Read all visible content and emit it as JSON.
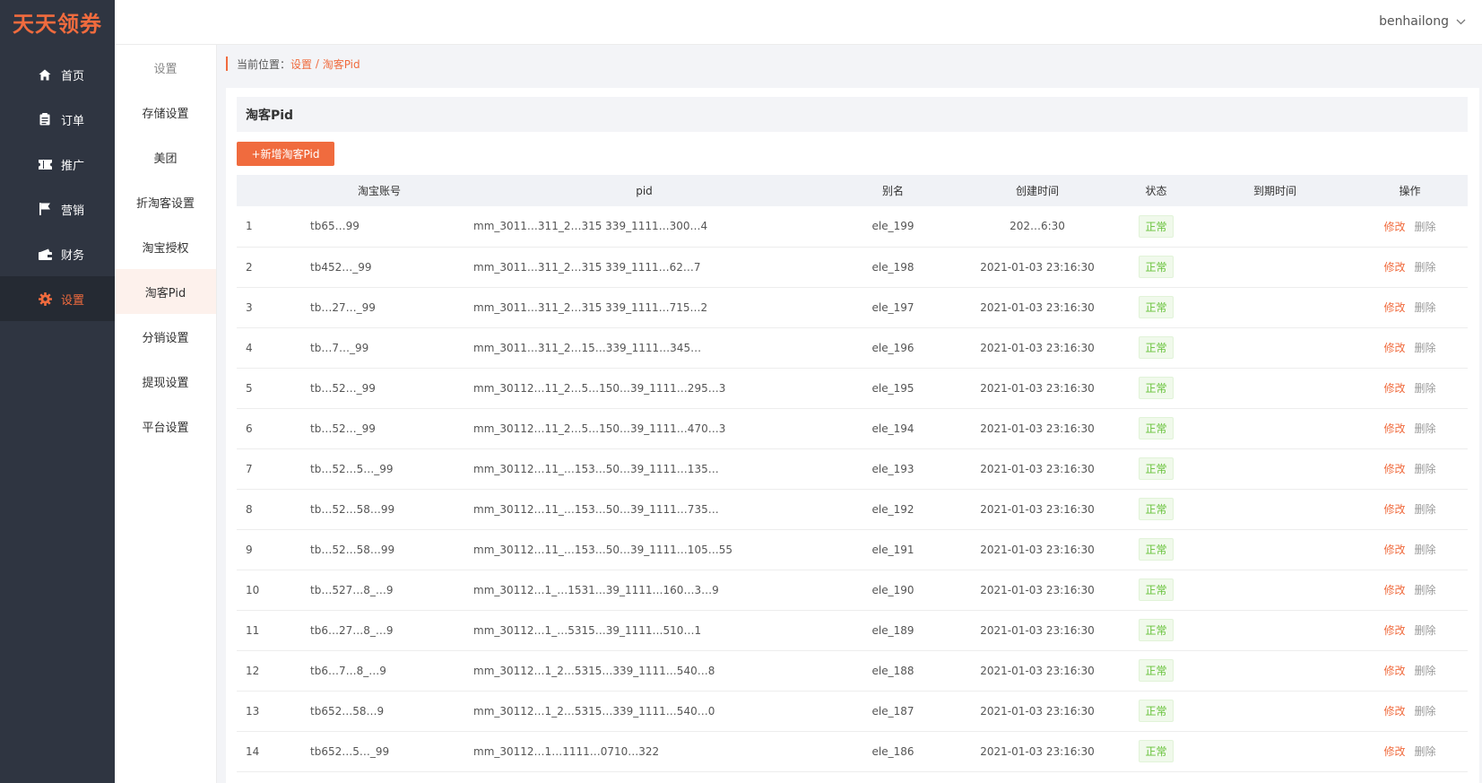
{
  "app": {
    "logo": "天天领券",
    "user": "benhailong"
  },
  "sidebar": [
    {
      "label": "首页",
      "icon": "home-icon",
      "active": false
    },
    {
      "label": "订单",
      "icon": "clipboard-icon",
      "active": false
    },
    {
      "label": "推广",
      "icon": "ticket-icon",
      "active": false
    },
    {
      "label": "营销",
      "icon": "flag-icon",
      "active": false
    },
    {
      "label": "财务",
      "icon": "wallet-icon",
      "active": false
    },
    {
      "label": "设置",
      "icon": "gear-icon",
      "active": true
    }
  ],
  "submenu": {
    "title": "设置",
    "items": [
      {
        "label": "存储设置",
        "active": false
      },
      {
        "label": "美团",
        "active": false
      },
      {
        "label": "折淘客设置",
        "active": false
      },
      {
        "label": "淘宝授权",
        "active": false
      },
      {
        "label": "淘客Pid",
        "active": true
      },
      {
        "label": "分销设置",
        "active": false
      },
      {
        "label": "提现设置",
        "active": false
      },
      {
        "label": "平台设置",
        "active": false
      }
    ]
  },
  "breadcrumb": {
    "prefix": "当前位置：",
    "parent": "设置",
    "separator": " / ",
    "current": "淘客Pid"
  },
  "panel": {
    "title": "淘客Pid",
    "add_button": "+新增淘客Pid"
  },
  "table": {
    "columns": [
      "",
      "淘宝账号",
      "pid",
      "别名",
      "创建时间",
      "状态",
      "到期时间",
      "操作"
    ],
    "actions": {
      "edit": "修改",
      "delete": "删除"
    },
    "rows": [
      {
        "no": "1",
        "account": "tb65…99",
        "pid": "mm_3011…311_2…315 339_1111…300…4",
        "alias": "ele_199",
        "created": "202…6:30",
        "status": "正常",
        "expire": ""
      },
      {
        "no": "2",
        "account": "tb452…_99",
        "pid": "mm_3011…311_2…315 339_1111…62…7",
        "alias": "ele_198",
        "created": "2021-01-03 23:16:30",
        "status": "正常",
        "expire": ""
      },
      {
        "no": "3",
        "account": "tb…27…_99",
        "pid": "mm_3011…311_2…315 339_1111…715…2",
        "alias": "ele_197",
        "created": "2021-01-03 23:16:30",
        "status": "正常",
        "expire": ""
      },
      {
        "no": "4",
        "account": "tb…7…_99",
        "pid": "mm_3011…311_2…15…339_1111…345…",
        "alias": "ele_196",
        "created": "2021-01-03 23:16:30",
        "status": "正常",
        "expire": ""
      },
      {
        "no": "5",
        "account": "tb…52…_99",
        "pid": "mm_30112…11_2…5…150…39_1111…295…3",
        "alias": "ele_195",
        "created": "2021-01-03 23:16:30",
        "status": "正常",
        "expire": ""
      },
      {
        "no": "6",
        "account": "tb…52…_99",
        "pid": "mm_30112…11_2…5…150…39_1111…470…3",
        "alias": "ele_194",
        "created": "2021-01-03 23:16:30",
        "status": "正常",
        "expire": ""
      },
      {
        "no": "7",
        "account": "tb…52…5…_99",
        "pid": "mm_30112…11_…153…50…39_1111…135…",
        "alias": "ele_193",
        "created": "2021-01-03 23:16:30",
        "status": "正常",
        "expire": ""
      },
      {
        "no": "8",
        "account": "tb…52…58…99",
        "pid": "mm_30112…11_…153…50…39_1111…735…",
        "alias": "ele_192",
        "created": "2021-01-03 23:16:30",
        "status": "正常",
        "expire": ""
      },
      {
        "no": "9",
        "account": "tb…52…58…99",
        "pid": "mm_30112…11_…153…50…39_1111…105…55",
        "alias": "ele_191",
        "created": "2021-01-03 23:16:30",
        "status": "正常",
        "expire": ""
      },
      {
        "no": "10",
        "account": "tb…527…8_…9",
        "pid": "mm_30112…1_…1531…39_1111…160…3…9",
        "alias": "ele_190",
        "created": "2021-01-03 23:16:30",
        "status": "正常",
        "expire": ""
      },
      {
        "no": "11",
        "account": "tb6…27…8_…9",
        "pid": "mm_30112…1_…5315…39_1111…510…1",
        "alias": "ele_189",
        "created": "2021-01-03 23:16:30",
        "status": "正常",
        "expire": ""
      },
      {
        "no": "12",
        "account": "tb6…7…8_…9",
        "pid": "mm_30112…1_2…5315…339_1111…540…8",
        "alias": "ele_188",
        "created": "2021-01-03 23:16:30",
        "status": "正常",
        "expire": ""
      },
      {
        "no": "13",
        "account": "tb652…58…9",
        "pid": "mm_30112…1_2…5315…339_1111…540…0",
        "alias": "ele_187",
        "created": "2021-01-03 23:16:30",
        "status": "正常",
        "expire": ""
      },
      {
        "no": "14",
        "account": "tb652…5…_99",
        "pid": "mm_30112…1…1111…0710…322",
        "alias": "ele_186",
        "created": "2021-01-03 23:16:30",
        "status": "正常",
        "expire": ""
      }
    ]
  }
}
